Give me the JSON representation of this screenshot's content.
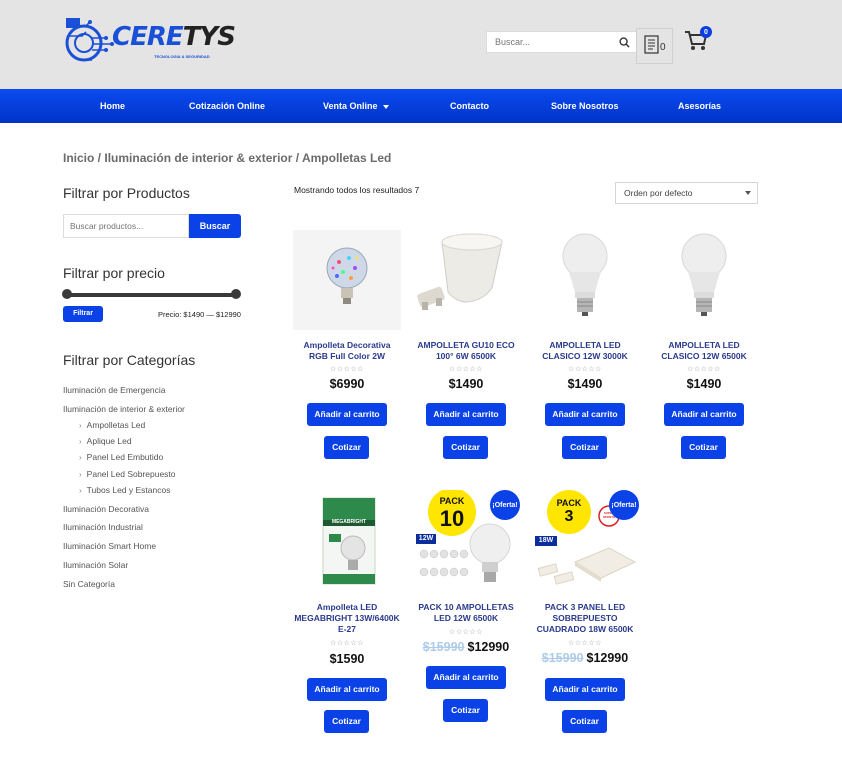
{
  "header": {
    "logo_text_a": "CERE",
    "logo_text_b": "TYS",
    "logo_tagline": "TECNOLOGIA & SEGURIDAD",
    "search_placeholder": "Buscar...",
    "quote_count": "0",
    "cart_count": "0"
  },
  "nav": {
    "items": [
      {
        "label": "Home"
      },
      {
        "label": "Cotización Online"
      },
      {
        "label": "Venta Online"
      },
      {
        "label": "Contacto"
      },
      {
        "label": "Sobre Nosotros"
      },
      {
        "label": "Asesorías"
      }
    ]
  },
  "breadcrumb": {
    "home": "Inicio",
    "sep": " / ",
    "category": "Iluminación de interior & exterior",
    "current": "Ampolletas Led"
  },
  "sidebar": {
    "filter_products_title": "Filtrar por Productos",
    "product_search_placeholder": "Buscar productos...",
    "product_search_button": "Buscar",
    "filter_price_title": "Filtrar por precio",
    "filter_button": "Filtrar",
    "price_label": "Precio: $1490 — $12990",
    "price_min": 1490,
    "price_max": 12990,
    "categories_title": "Filtrar por Categorías",
    "categories": [
      {
        "label": "Iluminación de Emergencia"
      },
      {
        "label": "Iluminación de interior & exterior"
      },
      {
        "label": "Ampolletas Led"
      },
      {
        "label": "Aplique Led"
      },
      {
        "label": "Panel Led Embutido"
      },
      {
        "label": "Panel Led Sobrepuesto"
      },
      {
        "label": "Tubos Led y Estancos"
      },
      {
        "label": "Iluminación Decorativa"
      },
      {
        "label": "Iluminación Industrial"
      },
      {
        "label": "Iluminación Smart Home"
      },
      {
        "label": "Iluminación Solar"
      },
      {
        "label": "Sin Categoría"
      }
    ]
  },
  "shop": {
    "results_text": "Mostrando todos los resultados 7",
    "orderby": "Orden por defecto",
    "add_to_cart": "Añadir al carrito",
    "quote": "Cotizar",
    "stars": "☆☆☆☆☆",
    "sale_badge": "¡Oferta!",
    "products": [
      {
        "name": "Ampolleta Decorativa RGB Full Color 2W",
        "price": "$6990",
        "old_price": ""
      },
      {
        "name": "AMPOLLETA GU10 ECO 100° 6W 6500K",
        "price": "$1490",
        "old_price": ""
      },
      {
        "name": "AMPOLLETA LED CLASICO 12W 3000K",
        "price": "$1490",
        "old_price": ""
      },
      {
        "name": "AMPOLLETA LED CLASICO 12W 6500K",
        "price": "$1490",
        "old_price": ""
      },
      {
        "name": "Ampolleta LED MEGABRIGHT 13W/6400K E-27",
        "price": "$1590",
        "old_price": ""
      },
      {
        "name": "PACK 10 AMPOLLETAS LED 12W 6500K",
        "price": "$12990",
        "old_price": "$15990"
      },
      {
        "name": "PACK 3 PANEL LED SOBREPUESTO CUADRADO 18W 6500K",
        "price": "$12990",
        "old_price": "$15990"
      }
    ],
    "pack10": {
      "pack": "PACK",
      "num": "10",
      "watt": "12W"
    },
    "pack3": {
      "pack": "PACK",
      "num": "3",
      "watt": "18W",
      "super": "SUPER OFERTA"
    },
    "megabright_box": "MEGABRIGHT"
  }
}
